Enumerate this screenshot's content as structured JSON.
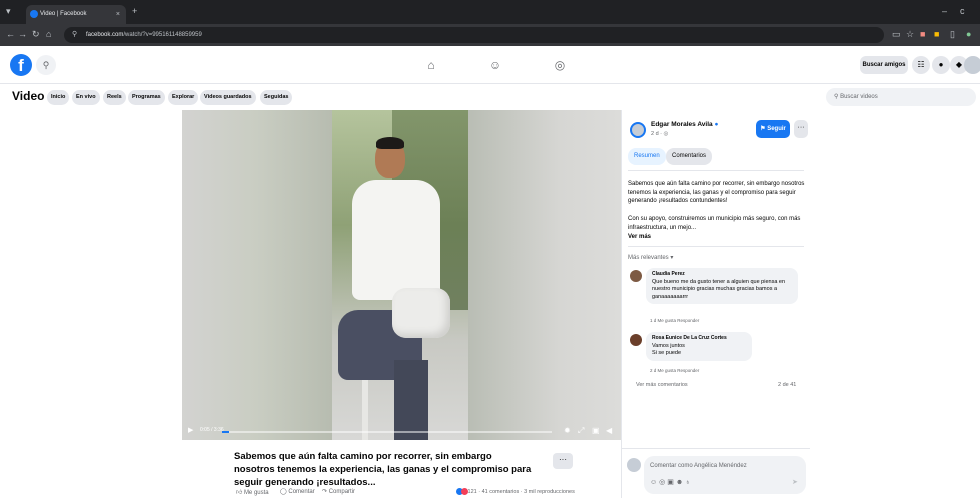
{
  "browser": {
    "tab_title": "Video | Facebook",
    "tab_close": "×",
    "new_tab": "+",
    "url_domain": "facebook.com",
    "url_path": "/watch/?v=995161148859959",
    "window_min": "–",
    "window_close": "c"
  },
  "header": {
    "logo": "f",
    "find_friends": "Buscar amigos"
  },
  "video_nav": {
    "title": "Video",
    "tabs": [
      "Inicio",
      "En vivo",
      "Reels",
      "Programas",
      "Explorar",
      "Videos guardados",
      "Seguidas"
    ],
    "search_placeholder": "Buscar videos"
  },
  "player": {
    "timecode": "0:05 / 3:36",
    "progress_fraction": 0.02
  },
  "caption": {
    "text": "Sabemos que aún falta camino por recorrer, sin embargo nosotros tenemos la experiencia, las ganas y el compromiso para seguir generando ¡resultados...",
    "more": "···"
  },
  "actions": {
    "like": "Me gusta",
    "comment": "Comentar",
    "share": "Compartir",
    "stats": "121 · 41 comentarios · 3 mil reproducciones"
  },
  "panel": {
    "author": "Edgar Morales Avila",
    "verified": "●",
    "time": "2 d · ◎",
    "follow": "Seguir",
    "more": "···",
    "tab_summary": "Resumen",
    "tab_comments": "Comentarios",
    "desc1": "Sabemos que aún falta camino por recorrer, sin embargo nosotros tenemos la experiencia, las ganas y el compromiso para seguir generando ¡resultados contundentes!",
    "desc2": "Con su apoyo, construiremos un municipio más seguro, con más infraestructura, un mejo...",
    "see_more": "Ver más",
    "relevant": "Más relevantes ▾",
    "comments": [
      {
        "name": "Claudia Perez",
        "text": "Que bueno me da gusto tener a alguien que piensa en nuestro municipio gracias muchas gracias bamos a ganaaaaaaarrr",
        "meta": "1 d    Me gusta    Responder"
      },
      {
        "name": "Rosa Eunice De La Cruz Cortes",
        "text": "Vamos juntos\nSi se puede",
        "meta": "2 d    Me gusta    Responder"
      }
    ],
    "more_comments": "Ver más comentarios",
    "comment_count": "2 de 41",
    "comment_placeholder": "Comentar como Angélica Menéndez"
  }
}
